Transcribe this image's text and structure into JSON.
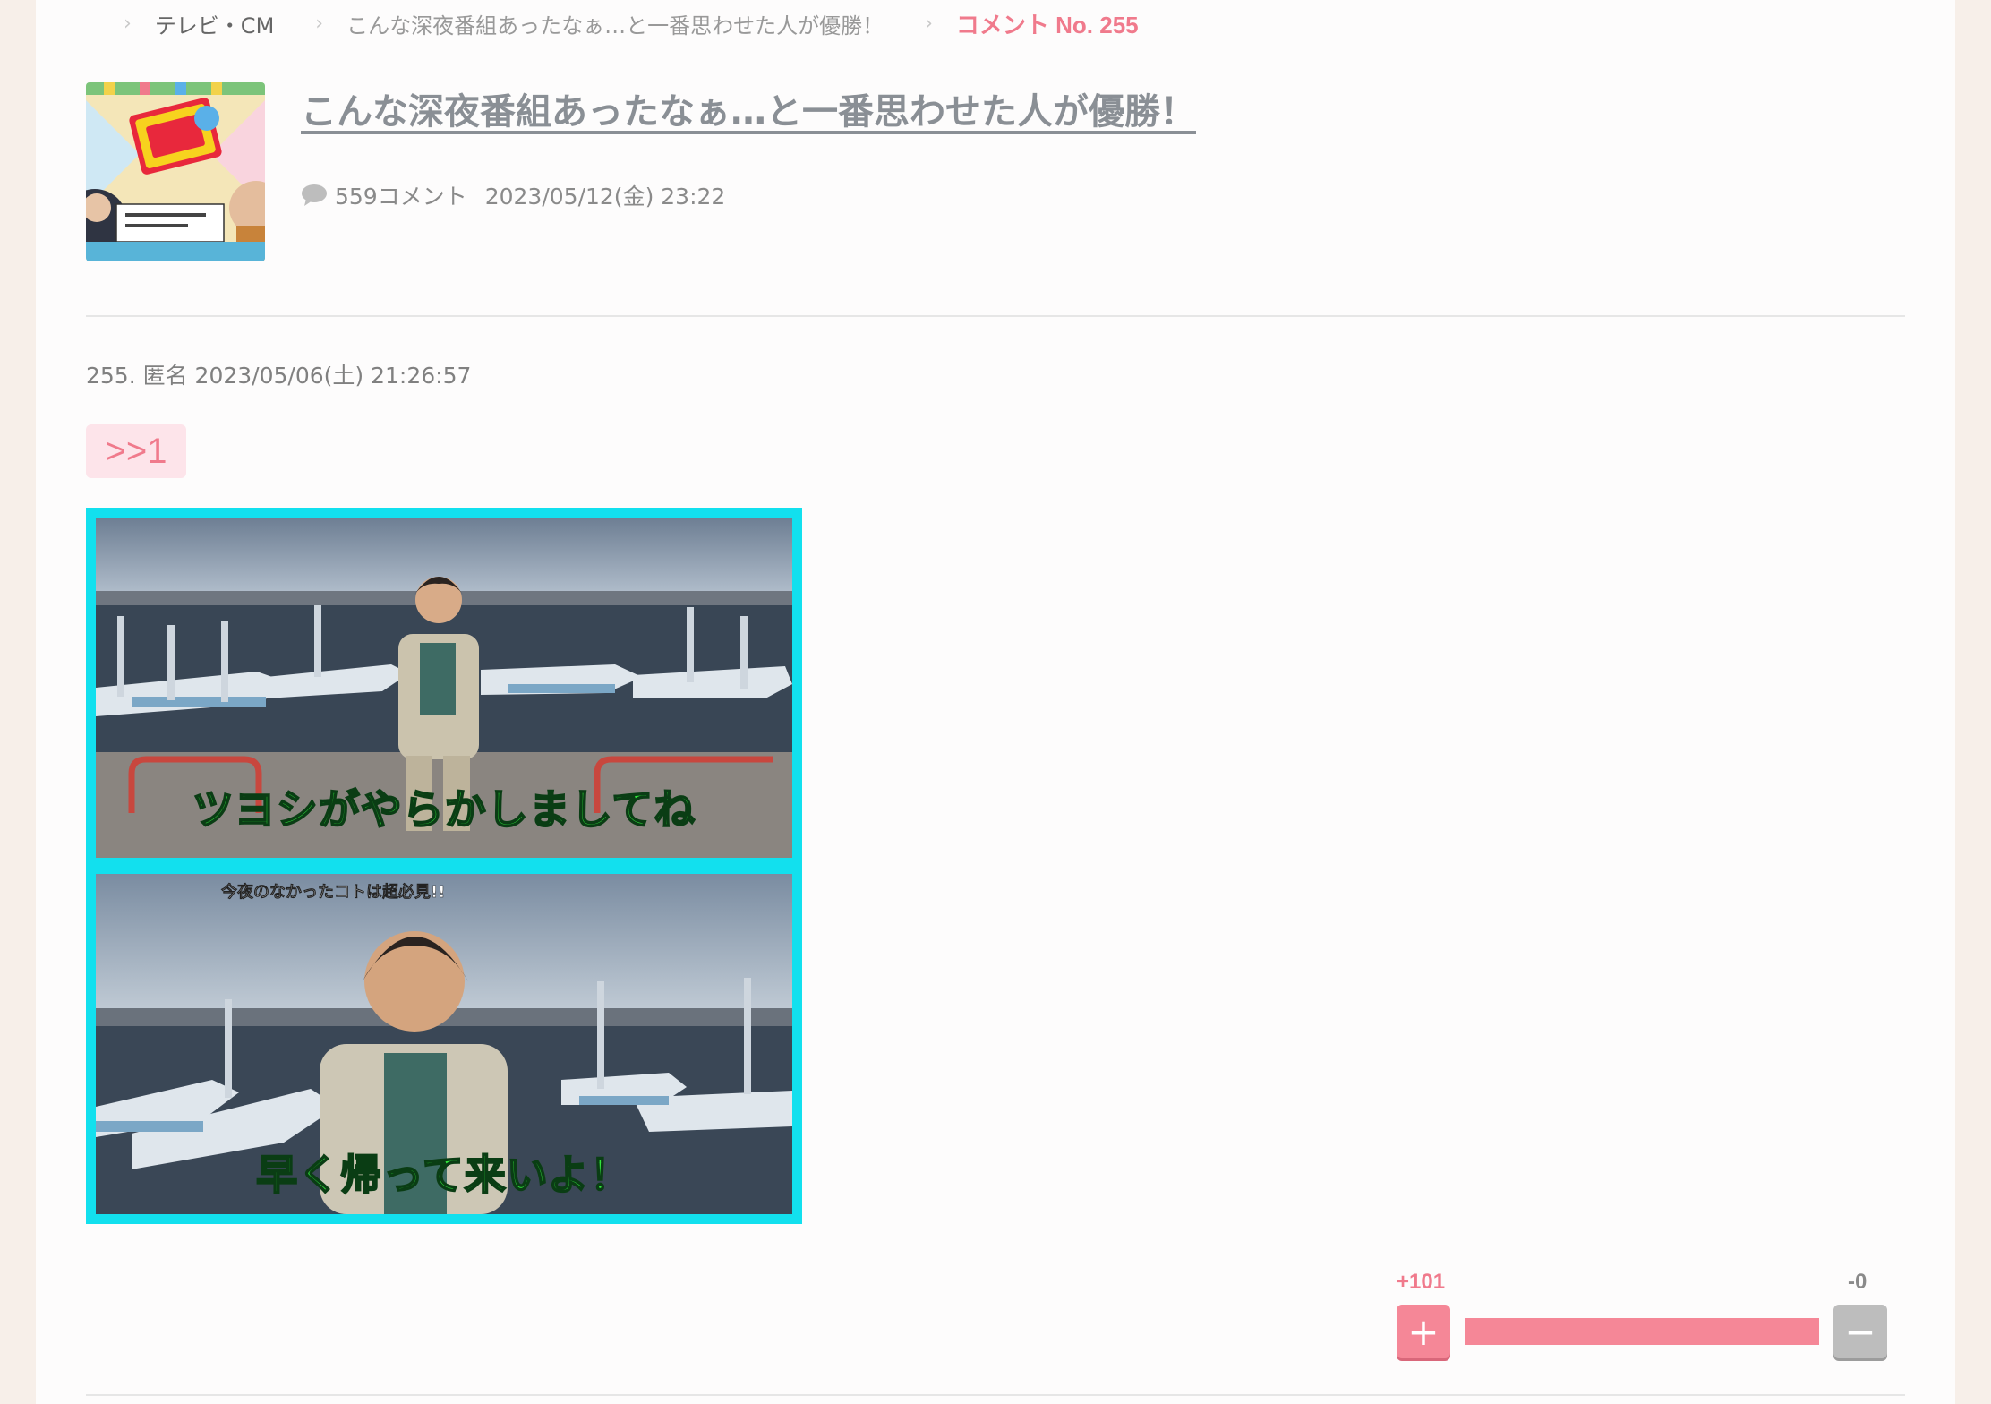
{
  "breadcrumb": {
    "items": [
      {
        "label": "テレビ・CM"
      },
      {
        "label": "こんな深夜番組あったなぁ…と一番思わせた人が優勝！"
      },
      {
        "label": "コメント No. 255"
      }
    ]
  },
  "topic": {
    "title": "こんな深夜番組あったなぁ…と一番思わせた人が優勝！",
    "comment_count": "559コメント",
    "date": "2023/05/12(金) 23:22"
  },
  "comment": {
    "header": "255. 匿名 2023/05/06(土) 21:26:57",
    "anchor": ">>1",
    "image": {
      "top_caption": "ツヨシがやらかしましてね",
      "bottom_caption": "早く帰って来いよ！",
      "bottom_overlay": "今夜のなかったコトは超必見!!"
    }
  },
  "votes": {
    "plus_label": "+101",
    "minus_label": "-0",
    "plus_ratio": 1.0,
    "plus_icon": "plus-icon",
    "minus_icon": "minus-icon"
  },
  "colors": {
    "accent": "#f07a8c",
    "image_border": "#12e0ee",
    "background": "#f7efe9"
  }
}
